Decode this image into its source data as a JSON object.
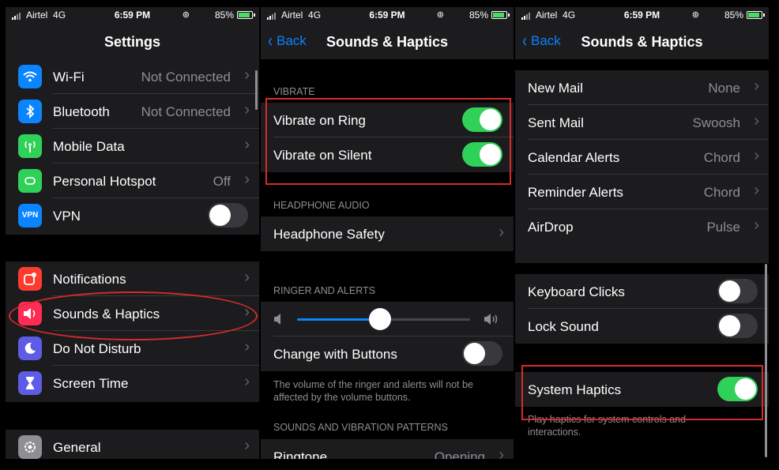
{
  "status": {
    "carrier": "Airtel",
    "network": "4G",
    "time": "6:59 PM",
    "battery": "85%"
  },
  "colors": {
    "accent": "#0a84ff",
    "toggle_on": "#30d158",
    "annotation": "#d52b2b",
    "background": "#000000",
    "cell": "#1c1c1e"
  },
  "settings": {
    "title": "Settings",
    "network_items": [
      {
        "label": "Wi-Fi",
        "value": "Not Connected",
        "icon": "wifi-icon",
        "color": "#0a84ff"
      },
      {
        "label": "Bluetooth",
        "value": "Not Connected",
        "icon": "bluetooth-icon",
        "color": "#0a84ff"
      },
      {
        "label": "Mobile Data",
        "value": "",
        "icon": "antenna-icon",
        "color": "#30d158"
      },
      {
        "label": "Personal Hotspot",
        "value": "Off",
        "icon": "hotspot-icon",
        "color": "#30d158"
      },
      {
        "label": "VPN",
        "icon": "vpn-icon",
        "color": "#0a84ff",
        "icon_text": "VPN",
        "toggle": false
      }
    ],
    "app_items": [
      {
        "label": "Notifications",
        "icon": "notifications-icon",
        "color": "#ff3b30"
      },
      {
        "label": "Sounds & Haptics",
        "icon": "speaker-icon",
        "color": "#ff2d55"
      },
      {
        "label": "Do Not Disturb",
        "icon": "moon-icon",
        "color": "#5e5ce6"
      },
      {
        "label": "Screen Time",
        "icon": "hourglass-icon",
        "color": "#5e5ce6"
      }
    ],
    "general_items": [
      {
        "label": "General",
        "icon": "gear-icon",
        "color": "#8e8e93"
      }
    ]
  },
  "sounds": {
    "back_label": "Back",
    "title": "Sounds & Haptics",
    "vibrate_header": "VIBRATE",
    "vibrate_ring": {
      "label": "Vibrate on Ring",
      "on": true
    },
    "vibrate_silent": {
      "label": "Vibrate on Silent",
      "on": true
    },
    "headphone_header": "HEADPHONE AUDIO",
    "headphone_safety": "Headphone Safety",
    "ringer_header": "RINGER AND ALERTS",
    "ringer_volume": 0.48,
    "change_with_buttons": {
      "label": "Change with Buttons",
      "on": false
    },
    "ringer_footer": "The volume of the ringer and alerts will not be affected by the volume buttons.",
    "patterns_header": "SOUNDS AND VIBRATION PATTERNS",
    "ringtone": {
      "label": "Ringtone",
      "value": "Opening"
    }
  },
  "sounds2": {
    "back_label": "Back",
    "title": "Sounds & Haptics",
    "patterns": [
      {
        "label": "New Mail",
        "value": "None"
      },
      {
        "label": "Sent Mail",
        "value": "Swoosh"
      },
      {
        "label": "Calendar Alerts",
        "value": "Chord"
      },
      {
        "label": "Reminder Alerts",
        "value": "Chord"
      },
      {
        "label": "AirDrop",
        "value": "Pulse"
      }
    ],
    "keyboard_clicks": {
      "label": "Keyboard Clicks",
      "on": false
    },
    "lock_sound": {
      "label": "Lock Sound",
      "on": false
    },
    "system_haptics": {
      "label": "System Haptics",
      "on": true
    },
    "haptics_footer": "Play haptics for system controls and interactions."
  }
}
